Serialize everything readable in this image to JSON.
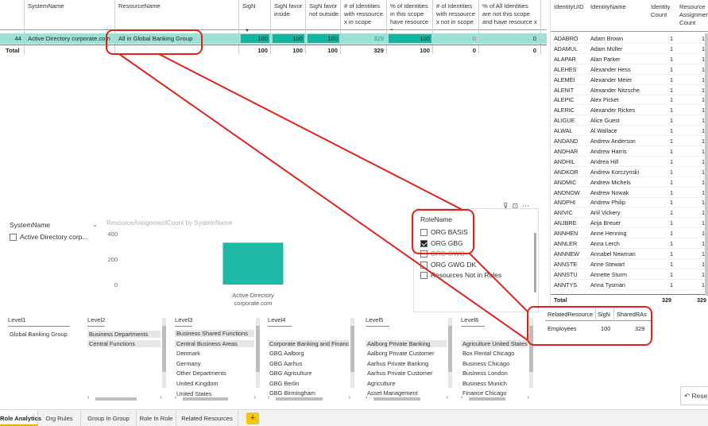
{
  "top_table": {
    "headers": {
      "system": "SystemName",
      "resource": "ResourceName",
      "sign": "SigN",
      "sign_favor_inside": "SigN favor inside",
      "sign_favor_not_outside": "SigN favor not outside",
      "identities_in_scope": "# of Identities with ressource x in scope",
      "pct_in_scope": "% of Identities in this scope have resource x",
      "identities_not_in_scope": "# of Identities with ressource x not in scope",
      "pct_all_not_in_scope": "% of All Identities are not this scope and have resource x"
    },
    "row": {
      "id": "44",
      "system": "Active Directory corporate.com",
      "resource": "All in Global Banking Group",
      "sign": "100",
      "sign_favor_inside": "100",
      "sign_favor_not_outside": "100",
      "identities_in_scope": "329",
      "pct_in_scope": "100",
      "identities_not_in_scope": "0",
      "pct_all_not_in_scope": "0"
    },
    "total": {
      "label": "Total",
      "sign": "100",
      "sign_favor_inside": "100",
      "sign_favor_not_outside": "100",
      "identities_in_scope": "329",
      "pct_in_scope": "100",
      "identities_not_in_scope": "0",
      "pct_all_not_in_scope": "0"
    }
  },
  "identity_table": {
    "headers": {
      "uid": "IdentityUID",
      "name": "IdentityName",
      "count": "Identity Count",
      "assign": "Resource Assignment Count"
    },
    "rows": [
      {
        "uid": "ADABRO",
        "name": "Adam Brown",
        "count": "1",
        "assign": "1"
      },
      {
        "uid": "ADAMUL",
        "name": "Adam Müller",
        "count": "1",
        "assign": "1"
      },
      {
        "uid": "ALAPAR",
        "name": "Alan Parker",
        "count": "1",
        "assign": "1"
      },
      {
        "uid": "ALEHES",
        "name": "Alexander Hess",
        "count": "1",
        "assign": "1"
      },
      {
        "uid": "ALEMEI",
        "name": "Alexander Meier",
        "count": "1",
        "assign": "1"
      },
      {
        "uid": "ALENIT",
        "name": "Alexander Nitzsche",
        "count": "1",
        "assign": "1"
      },
      {
        "uid": "ALEPIC",
        "name": "Alex Picket",
        "count": "1",
        "assign": "1"
      },
      {
        "uid": "ALERIC",
        "name": "Alexander Rickes",
        "count": "1",
        "assign": "1"
      },
      {
        "uid": "ALIGUE",
        "name": "Alice Guest",
        "count": "1",
        "assign": "1"
      },
      {
        "uid": "ALWAL",
        "name": "Al Wallace",
        "count": "1",
        "assign": "1"
      },
      {
        "uid": "ANDAND",
        "name": "Andrew Anderson",
        "count": "1",
        "assign": "1"
      },
      {
        "uid": "ANDHAR",
        "name": "Andrew Harris",
        "count": "1",
        "assign": "1"
      },
      {
        "uid": "ANDHIL",
        "name": "Andrea Hill",
        "count": "1",
        "assign": "1"
      },
      {
        "uid": "ANDKOR",
        "name": "Andrew Korczynski",
        "count": "1",
        "assign": "1"
      },
      {
        "uid": "ANDMIC",
        "name": "Andrew Michels",
        "count": "1",
        "assign": "1"
      },
      {
        "uid": "ANDNOW",
        "name": "Andrew Nowak",
        "count": "1",
        "assign": "1"
      },
      {
        "uid": "ANDPHI",
        "name": "Andrew Philip",
        "count": "1",
        "assign": "1"
      },
      {
        "uid": "ANIVIC",
        "name": "Anil Vickery",
        "count": "1",
        "assign": "1"
      },
      {
        "uid": "ANJBRE",
        "name": "Anja Breuer",
        "count": "1",
        "assign": "1"
      },
      {
        "uid": "ANNHEN",
        "name": "Anne Henning",
        "count": "1",
        "assign": "1"
      },
      {
        "uid": "ANNLER",
        "name": "Anna Lerch",
        "count": "1",
        "assign": "1"
      },
      {
        "uid": "ANNNEW",
        "name": "Annabel Newman",
        "count": "1",
        "assign": "1"
      },
      {
        "uid": "ANNSTE",
        "name": "Anne Stewart",
        "count": "1",
        "assign": "1"
      },
      {
        "uid": "ANNSTU",
        "name": "Annette Sturm",
        "count": "1",
        "assign": "1"
      },
      {
        "uid": "ANNTYS",
        "name": "Anna Tysman",
        "count": "1",
        "assign": "1"
      }
    ],
    "total": {
      "label": "Total",
      "count": "329",
      "assign": "329"
    }
  },
  "system_slicer": {
    "title": "SystemName",
    "item": "Active Directory corp..."
  },
  "chart_data": {
    "type": "bar",
    "title": "ResourceAssignmentCount by SystemName",
    "categories": [
      "Active Directory corporate.com"
    ],
    "category_lines": [
      "Active Directory",
      "corporate.com"
    ],
    "values": [
      329
    ],
    "yticks": [
      0,
      200,
      400
    ],
    "ylim": [
      0,
      400
    ],
    "color": "#1fb8a6"
  },
  "role_slicer": {
    "title": "RoleName",
    "items": [
      {
        "label": "ORG BASIS",
        "checked": false
      },
      {
        "label": "ORG GBG",
        "checked": true
      },
      {
        "label": "ORG GWG",
        "checked": false
      },
      {
        "label": "ORG GWG DK",
        "checked": false
      },
      {
        "label": "Resources Not in Roles",
        "checked": false
      }
    ]
  },
  "related_table": {
    "headers": {
      "resource": "RelatedResource",
      "sign": "SigN",
      "shared": "SharedRAs"
    },
    "row": {
      "resource": "Employees",
      "sign": "100",
      "shared": "329"
    }
  },
  "levels": [
    {
      "title": "Level1",
      "items": [
        "Global Banking Group"
      ],
      "selected": []
    },
    {
      "title": "Level2",
      "items": [
        "Business Departments",
        "Central Functions"
      ],
      "selected": [
        0,
        1
      ]
    },
    {
      "title": "Level3",
      "items": [
        "Business Shared Functions",
        "Central Business Areas",
        "Denmark",
        "Germany",
        "Other Departments",
        "United Kingdom",
        "United States"
      ],
      "selected": [
        0,
        1
      ]
    },
    {
      "title": "Level4",
      "items": [
        "Corporate Banking and Finance",
        "GBG Aalborg",
        "GBG Aarhus",
        "GBG Agriculture",
        "GBG Berlin",
        "GBG Birmingham"
      ],
      "selected": [
        0
      ]
    },
    {
      "title": "Level5",
      "items": [
        "Aalborg Private Banking",
        "Aalborg Private Customer",
        "Aarhus Private Banking",
        "Aarhus Private Customer",
        "Agriculture",
        "Asset Management"
      ],
      "selected": [
        0
      ]
    },
    {
      "title": "Level6",
      "items": [
        "Agriculture United States",
        "Box Rental Chicago",
        "Business Chicago",
        "Business London",
        "Business Munich",
        "Finance Chicago"
      ],
      "selected": [
        0
      ]
    }
  ],
  "reset_button": {
    "label": "Reset"
  },
  "tabs": [
    {
      "label": "Role Analytics",
      "active": true
    },
    {
      "label": "Org Rules",
      "active": false
    },
    {
      "label": "Group In Group",
      "active": false
    },
    {
      "label": "Role In Role",
      "active": false
    },
    {
      "label": "Related Resources",
      "active": false
    }
  ],
  "colors": {
    "accent": "#13b4a0",
    "selection_row": "#9ee0d6",
    "annotation": "#e2231a",
    "tab_active": "#f2c811"
  }
}
